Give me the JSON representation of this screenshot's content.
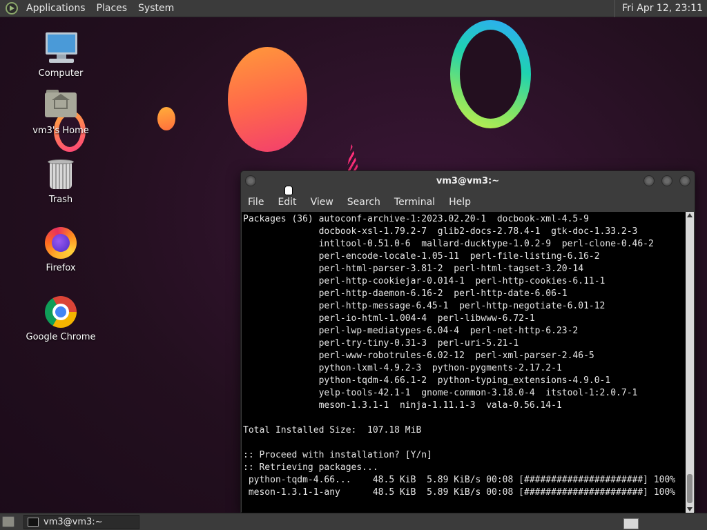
{
  "top_panel": {
    "menu": [
      "Applications",
      "Places",
      "System"
    ],
    "clock": "Fri Apr 12, 23:11"
  },
  "desktop_icons": [
    {
      "label": "Computer",
      "icon": "computer-icon"
    },
    {
      "label": "vm3's Home",
      "icon": "home-folder-icon"
    },
    {
      "label": "Trash",
      "icon": "trash-icon"
    },
    {
      "label": "Firefox",
      "icon": "firefox-icon"
    },
    {
      "label": "Google Chrome",
      "icon": "chrome-icon"
    }
  ],
  "terminal": {
    "title": "vm3@vm3:~",
    "menu": [
      "File",
      "Edit",
      "View",
      "Search",
      "Terminal",
      "Help"
    ],
    "lines": [
      "Packages (36) autoconf-archive-1:2023.02.20-1  docbook-xml-4.5-9",
      "              docbook-xsl-1.79.2-7  glib2-docs-2.78.4-1  gtk-doc-1.33.2-3",
      "              intltool-0.51.0-6  mallard-ducktype-1.0.2-9  perl-clone-0.46-2",
      "              perl-encode-locale-1.05-11  perl-file-listing-6.16-2",
      "              perl-html-parser-3.81-2  perl-html-tagset-3.20-14",
      "              perl-http-cookiejar-0.014-1  perl-http-cookies-6.11-1",
      "              perl-http-daemon-6.16-2  perl-http-date-6.06-1",
      "              perl-http-message-6.45-1  perl-http-negotiate-6.01-12",
      "              perl-io-html-1.004-4  perl-libwww-6.72-1",
      "              perl-lwp-mediatypes-6.04-4  perl-net-http-6.23-2",
      "              perl-try-tiny-0.31-3  perl-uri-5.21-1",
      "              perl-www-robotrules-6.02-12  perl-xml-parser-2.46-5",
      "              python-lxml-4.9.2-3  python-pygments-2.17.2-1",
      "              python-tqdm-4.66.1-2  python-typing_extensions-4.9.0-1",
      "              yelp-tools-42.1-1  gnome-common-3.18.0-4  itstool-1:2.0.7-1",
      "              meson-1.3.1-1  ninja-1.11.1-3  vala-0.56.14-1",
      "",
      "Total Installed Size:  107.18 MiB",
      "",
      ":: Proceed with installation? [Y/n]",
      ":: Retrieving packages...",
      " python-tqdm-4.66...    48.5 KiB  5.89 KiB/s 00:08 [######################] 100%",
      " meson-1.3.1-1-any      48.5 KiB  5.89 KiB/s 00:08 [######################] 100%"
    ]
  },
  "taskbar": {
    "items": [
      {
        "label": "vm3@vm3:~",
        "icon": "terminal-icon"
      }
    ]
  }
}
